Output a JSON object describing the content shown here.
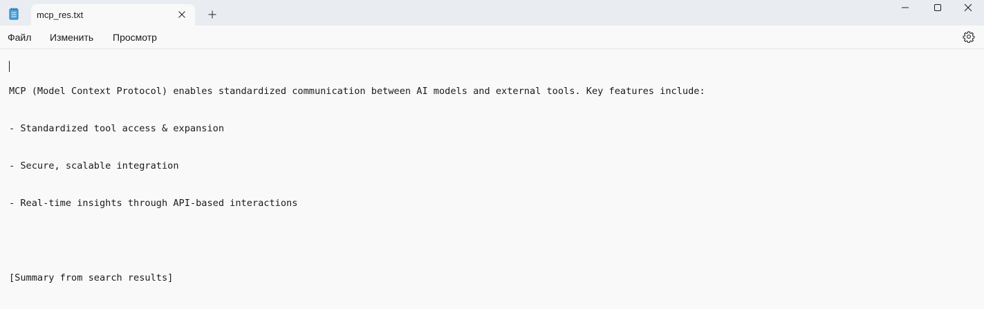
{
  "tab": {
    "title": "mcp_res.txt"
  },
  "menu": {
    "file": "Файл",
    "edit": "Изменить",
    "view": "Просмотр"
  },
  "document": {
    "lines": [
      "MCP (Model Context Protocol) enables standardized communication between AI models and external tools. Key features include:",
      "- Standardized tool access & expansion",
      "- Secure, scalable integration",
      "- Real-time insights through API-based interactions",
      "",
      "[Summary from search results]"
    ]
  },
  "icons": {
    "app": "notepad-icon",
    "close_tab": "close-icon",
    "new_tab": "plus-icon",
    "minimize": "minimize-icon",
    "maximize": "maximize-icon",
    "close_window": "close-icon",
    "settings": "gear-icon"
  },
  "colors": {
    "titlebar": "#e9edf1",
    "editor_bg": "#f9f9f9",
    "text": "#1a1a1a",
    "spellcheck": "#d13438"
  }
}
